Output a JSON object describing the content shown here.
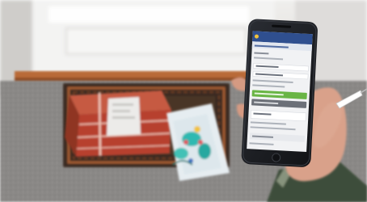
{
  "photo": {
    "phone_screen": {
      "header_text": "",
      "title_text": "",
      "rows": [
        "",
        "",
        "",
        "",
        "",
        ""
      ],
      "highlight_text": "",
      "button_text": ""
    }
  },
  "colors": {
    "wall": "#e9e9e7",
    "door_panel": "#f3f3f2",
    "door_trim": "#b96a38",
    "carpet": "#8b8987",
    "mat": "#3b2c22",
    "box_red": "#b7412f",
    "paper": "#ecebe9",
    "phone_body": "#1b1d22",
    "phone_header": "#2f4f8f",
    "app_green": "#69b545",
    "skin": "#d9a18a",
    "sleeve": "#3e4e3a"
  }
}
